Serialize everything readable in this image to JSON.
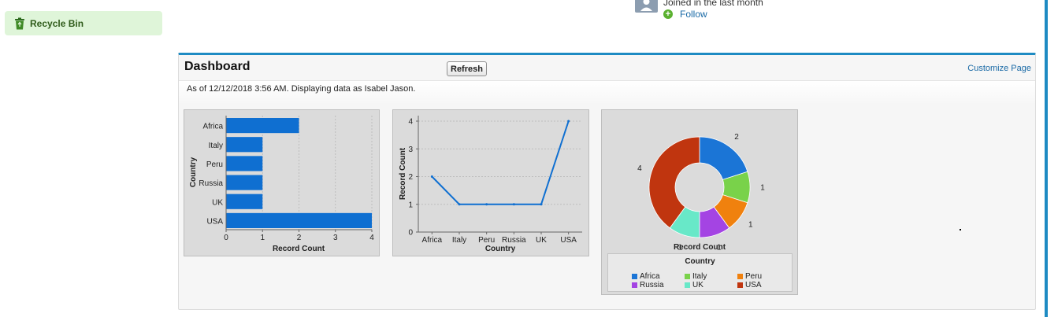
{
  "sidebar": {
    "recycle_bin_label": "Recycle Bin"
  },
  "profile": {
    "joined_text": "Joined in the last month",
    "follow_label": "Follow",
    "follow_icon": "+"
  },
  "dashboard": {
    "title": "Dashboard",
    "refresh_label": "Refresh",
    "customize_label": "Customize Page",
    "as_of_text": "As of 12/12/2018 3:56 AM. Displaying data as Isabel Jason."
  },
  "colors": {
    "bar": "#0f6fd1",
    "accent": "#1e8bc3",
    "link": "#1a6aa6"
  },
  "chart_data": [
    {
      "type": "bar",
      "orientation": "horizontal",
      "categories": [
        "Africa",
        "Italy",
        "Peru",
        "Russia",
        "UK",
        "USA"
      ],
      "values": [
        2,
        1,
        1,
        1,
        1,
        4
      ],
      "xlabel": "Record Count",
      "ylabel": "Country",
      "xlim": [
        0,
        4
      ],
      "xticks": [
        "0",
        "1",
        "2",
        "3",
        "4"
      ],
      "grid": true
    },
    {
      "type": "line",
      "categories": [
        "Africa",
        "Italy",
        "Peru",
        "Russia",
        "UK",
        "USA"
      ],
      "values": [
        2,
        1,
        1,
        1,
        1,
        4
      ],
      "xlabel": "Country",
      "ylabel": "Record Count",
      "ylim": [
        0,
        4
      ],
      "yticks": [
        "0",
        "1",
        "2",
        "3",
        "4"
      ],
      "grid": true
    },
    {
      "type": "pie",
      "donut": true,
      "categories": [
        "Africa",
        "Italy",
        "Peru",
        "Russia",
        "UK",
        "USA"
      ],
      "values": [
        2,
        1,
        1,
        1,
        1,
        4
      ],
      "labels": [
        "2",
        "1",
        "1",
        "1",
        "1",
        "4"
      ],
      "colors": [
        "#1b75d6",
        "#79d24a",
        "#f0810e",
        "#a444e3",
        "#68e8c8",
        "#c0350f"
      ],
      "xlabel": "Record Count",
      "legend_title": "Country",
      "legend_position": "bottom"
    }
  ]
}
